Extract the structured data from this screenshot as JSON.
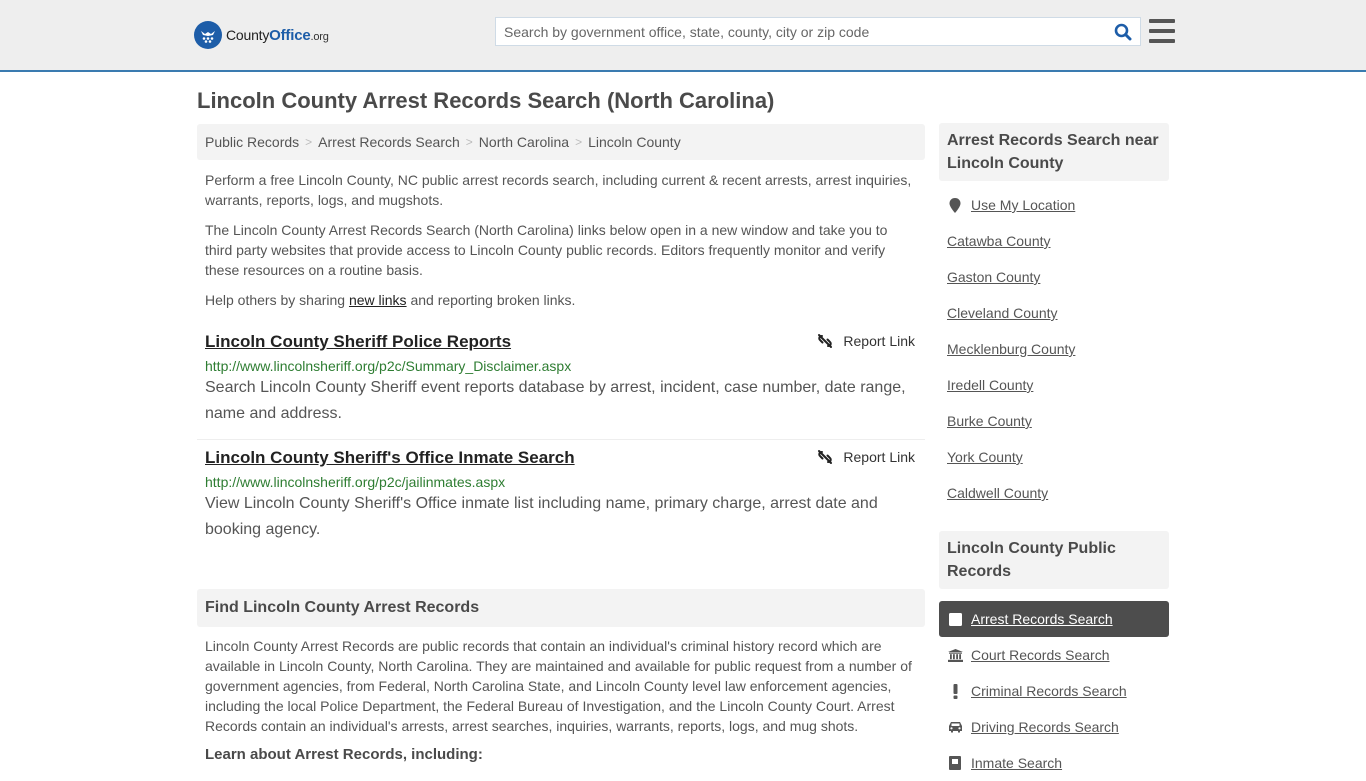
{
  "header": {
    "logo": {
      "text_main": "County",
      "text_brand": "Office",
      "text_tld": ".org"
    },
    "search": {
      "placeholder": "Search by government office, state, county, city or zip code",
      "value": ""
    },
    "colors": {
      "brand": "#1d5da8",
      "header_border": "#3a7bb0"
    }
  },
  "page": {
    "title": "Lincoln County Arrest Records Search (North Carolina)"
  },
  "breadcrumb": [
    {
      "label": "Public Records"
    },
    {
      "label": "Arrest Records Search"
    },
    {
      "label": "North Carolina"
    },
    {
      "label": "Lincoln County"
    }
  ],
  "intro": {
    "p1": "Perform a free Lincoln County, NC public arrest records search, including current & recent arrests, arrest inquiries, warrants, reports, logs, and mugshots.",
    "p2": "The Lincoln County Arrest Records Search (North Carolina) links below open in a new window and take you to third party websites that provide access to Lincoln County public records. Editors frequently monitor and verify these resources on a routine basis.",
    "p3_before": "Help others by sharing ",
    "p3_link": "new links",
    "p3_after": " and reporting broken links."
  },
  "results": [
    {
      "title": "Lincoln County Sheriff Police Reports",
      "url": "http://www.lincolnsheriff.org/p2c/Summary_Disclaimer.aspx",
      "description": "Search Lincoln County Sheriff event reports database by arrest, incident, case number, date range, name and address.",
      "report_label": "Report Link"
    },
    {
      "title": "Lincoln County Sheriff's Office Inmate Search",
      "url": "http://www.lincolnsheriff.org/p2c/jailinmates.aspx",
      "description": "View Lincoln County Sheriff's Office inmate list including name, primary charge, arrest date and booking agency.",
      "report_label": "Report Link"
    }
  ],
  "find_section": {
    "heading": "Find Lincoln County Arrest Records",
    "body": "Lincoln County Arrest Records are public records that contain an individual's criminal history record which are available in Lincoln County, North Carolina. They are maintained and available for public request from a number of government agencies, from Federal, North Carolina State, and Lincoln County level law enforcement agencies, including the local Police Department, the Federal Bureau of Investigation, and the Lincoln County Court. Arrest Records contain an individual's arrests, arrest searches, inquiries, warrants, reports, logs, and mug shots.",
    "learn_heading": "Learn about Arrest Records, including:"
  },
  "sidebar": {
    "nearby_heading": "Arrest Records Search near Lincoln County",
    "use_location": {
      "label": "Use My Location",
      "icon": "map-marker-icon"
    },
    "nearby": [
      {
        "label": "Catawba County"
      },
      {
        "label": "Gaston County"
      },
      {
        "label": "Cleveland County"
      },
      {
        "label": "Mecklenburg County"
      },
      {
        "label": "Iredell County"
      },
      {
        "label": "Burke County"
      },
      {
        "label": "York County"
      },
      {
        "label": "Caldwell County"
      }
    ],
    "public_records_heading": "Lincoln County Public Records",
    "public_records": [
      {
        "label": "Arrest Records Search",
        "icon": "square-icon",
        "active": true
      },
      {
        "label": "Court Records Search",
        "icon": "courthouse-icon"
      },
      {
        "label": "Criminal Records Search",
        "icon": "exclamation-icon"
      },
      {
        "label": "Driving Records Search",
        "icon": "car-icon"
      },
      {
        "label": "Inmate Search",
        "icon": "inmate-icon"
      }
    ]
  }
}
